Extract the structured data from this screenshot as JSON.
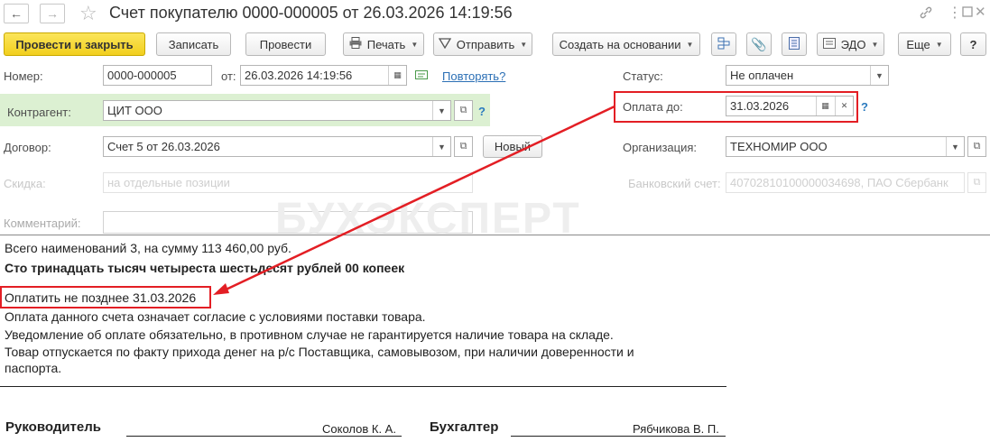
{
  "window": {
    "title": "Счет покупателю 0000-000005 от 26.03.2026 14:19:56",
    "back_icon": "arrow-left-icon",
    "forward_icon": "arrow-right-icon",
    "favorite_icon": "star-icon",
    "link_icon": "link-icon",
    "more_icon": "more-vertical-icon",
    "maximize_icon": "maximize-icon",
    "close_icon": "close-icon"
  },
  "toolbar": {
    "post_close": "Провести и закрыть",
    "save": "Записать",
    "post": "Провести",
    "print": "Печать",
    "send": "Отправить",
    "create_based": "Создать на основании",
    "edo": "ЭДО",
    "more": "Еще",
    "help": "?"
  },
  "form": {
    "number_label": "Номер:",
    "number_value": "0000-000005",
    "date_label": "от:",
    "date_value": "26.03.2026 14:19:56",
    "repeat_link": "Повторять?",
    "status_label": "Статус:",
    "status_value": "Не оплачен",
    "payment_due_label": "Оплата до:",
    "payment_due_value": "31.03.2026",
    "counterparty_label": "Контрагент:",
    "counterparty_value": "ЦИТ ООО",
    "contract_label": "Договор:",
    "contract_value": "Счет 5 от 26.03.2026",
    "new_button": "Новый",
    "organization_label": "Организация:",
    "organization_value": "ТЕХНОМИР ООО",
    "discount_label": "Скидка:",
    "discount_value": "на отдельные позиции",
    "bank_label": "Банковский счет:",
    "bank_value": "40702810100000034698, ПАО Сбербанк",
    "comment_label": "Комментарий:",
    "help_mark": "?"
  },
  "watermark": "БУХЭКСПЕРТ",
  "document": {
    "line1": "Всего наименований 3, на сумму 113 460,00 руб.",
    "line2": "Сто тринадцать тысяч четыреста шестьдесят рублей 00 копеек",
    "pay_deadline": "Оплатить не позднее 31.03.2026",
    "note1": "Оплата данного счета означает согласие с условиями поставки товара.",
    "note2": "Уведомление об оплате обязательно, в противном случае не гарантируется наличие товара на складе.",
    "note3a": "Товар отпускается по факту прихода денег на р/с Поставщика, самовывозом, при наличии доверенности и",
    "note3b": "паспорта.",
    "head_label": "Руководитель",
    "head_name": "Соколов К. А.",
    "accountant_label": "Бухгалтер",
    "accountant_name": "Рябчикова В. П."
  },
  "annotation_color": "#e31e24",
  "accent_color": "#f2cf1d"
}
